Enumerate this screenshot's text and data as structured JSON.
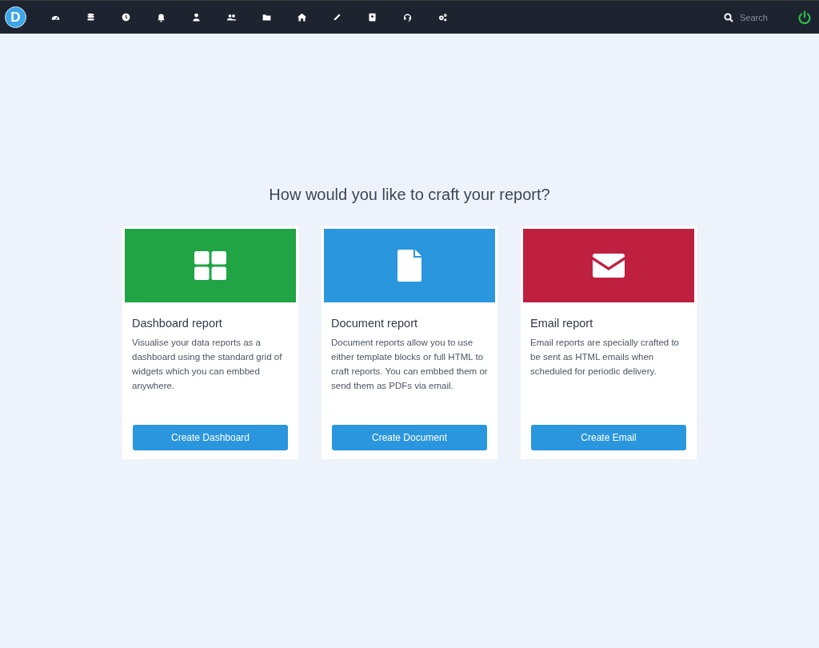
{
  "navbar": {
    "logo": "D",
    "search": {
      "placeholder": "Search"
    }
  },
  "heading": "How would you like to craft your report?",
  "cards": [
    {
      "kind": "grid",
      "color": "#20a444",
      "title": "Dashboard report",
      "description": "Visualise your data reports as a dashboard using the standard grid of widgets which you can embbed anywhere.",
      "button": "Create Dashboard"
    },
    {
      "kind": "document",
      "color": "#2a96de",
      "title": "Document report",
      "description": "Document reports allow you to use either template blocks or full HTML to craft reports. You can embbed them or send them as PDFs via email.",
      "button": "Create Document"
    },
    {
      "kind": "envelope",
      "color": "#c02040",
      "title": "Email report",
      "description": "Email reports are specially crafted to be sent as HTML emails when scheduled for periodic delivery.",
      "button": "Create Email"
    }
  ]
}
